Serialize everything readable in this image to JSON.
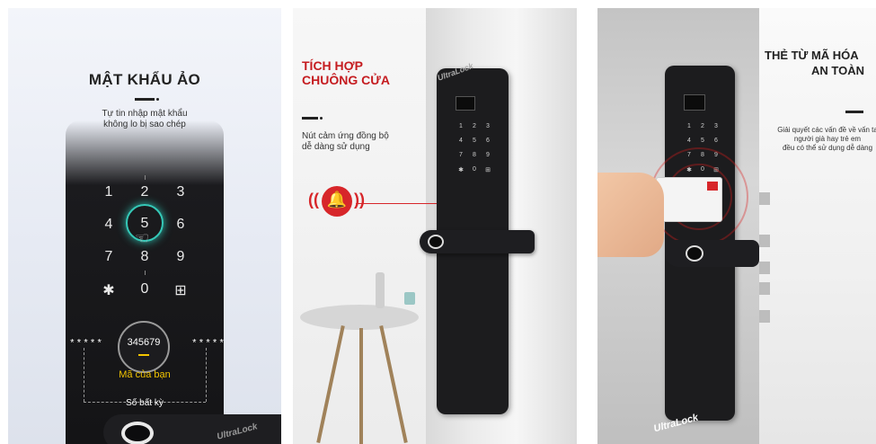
{
  "panel1": {
    "title": "MẬT KHẨU ẢO",
    "subtitle_line1": "Tự tin nhập mật khẩu",
    "subtitle_line2": "không lo bị sao chép",
    "keys": [
      "1",
      "2",
      "3",
      "4",
      "5",
      "6",
      "7",
      "8",
      "9",
      "✱",
      "0",
      "⊞"
    ],
    "stars": "*****",
    "code": "345679",
    "code_caption": "Mã của bạn",
    "random_caption": "Số bất kỳ",
    "brand": "UltraLock"
  },
  "panel2": {
    "title_line1": "TÍCH HỢP",
    "title_line2": "CHUÔNG CỬA",
    "subtitle_line1": "Nút cảm ứng đồng bộ",
    "subtitle_line2": "dễ dàng sử dụng",
    "keys": [
      "1",
      "2",
      "3",
      "4",
      "5",
      "6",
      "7",
      "8",
      "9",
      "✱",
      "0",
      "⊞"
    ],
    "brand": "UltraLock",
    "accent_color": "#d7262a"
  },
  "panel3": {
    "title_line1": "THẺ TỪ MÃ HÓA",
    "title_line2": "AN TOÀN",
    "subtitle_line1": "Giải quyết các vấn đề về vấn ta",
    "subtitle_line2": "người già hay trẻ em",
    "subtitle_line3": "đều có thể sử dụng dễ dàng",
    "keys": [
      "1",
      "2",
      "3",
      "4",
      "5",
      "6",
      "7",
      "8",
      "9",
      "✱",
      "0",
      "⊞"
    ],
    "brand": "UltraLock"
  }
}
